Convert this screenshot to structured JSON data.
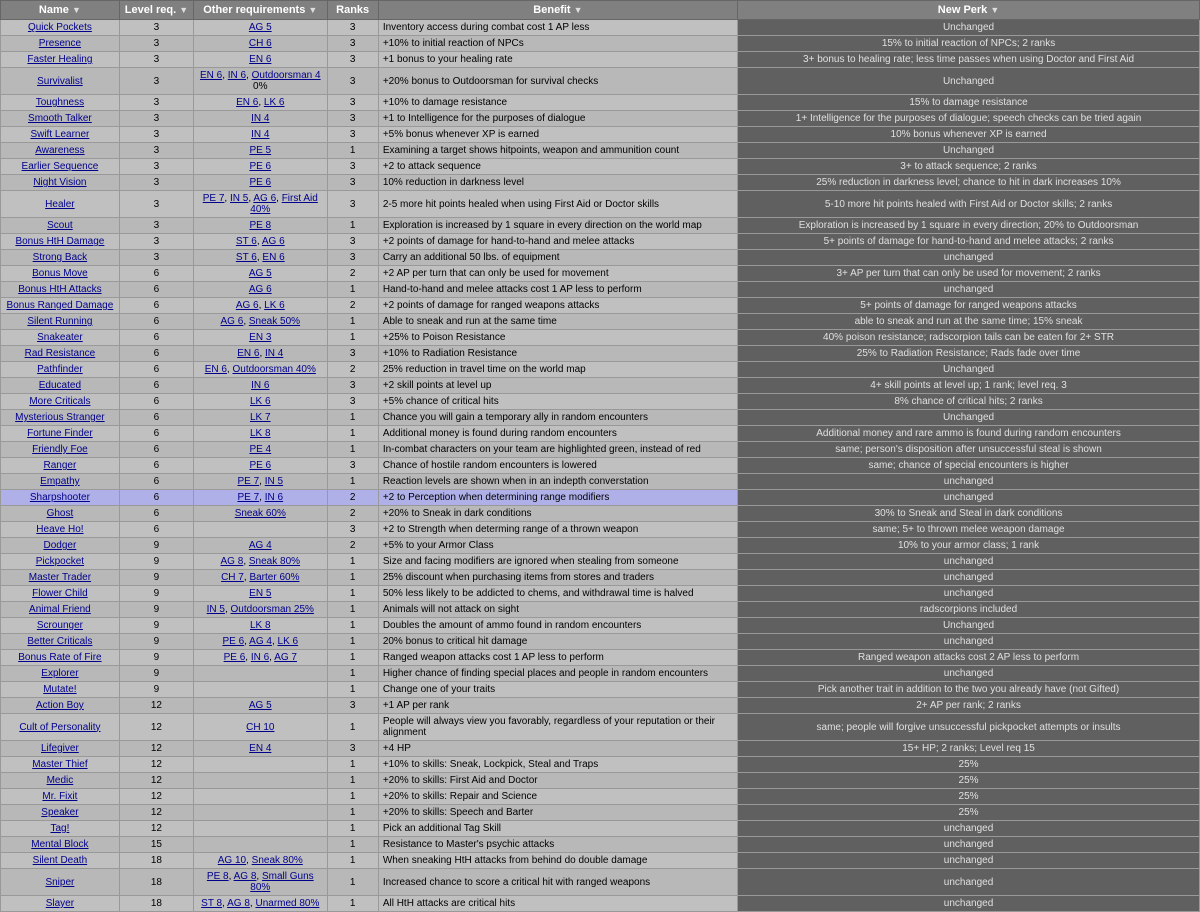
{
  "table": {
    "headers": [
      "Name",
      "Level req.",
      "Other requirements",
      "Ranks",
      "Benefit",
      "New Perk"
    ],
    "rows": [
      {
        "name": "Quick Pockets",
        "level": "3",
        "other": "AG 5",
        "ranks": "3",
        "benefit": "Inventory access during combat cost 1 AP less",
        "newperk": "Unchanged"
      },
      {
        "name": "Presence",
        "level": "3",
        "other": "CH 6",
        "ranks": "3",
        "benefit": "+10% to initial reaction of NPCs",
        "newperk": "15% to initial reaction of NPCs; 2 ranks"
      },
      {
        "name": "Faster Healing",
        "level": "3",
        "other": "EN 6",
        "ranks": "3",
        "benefit": "+1 bonus to your healing rate",
        "newperk": "3+ bonus to healing rate; less time passes when using Doctor and First Aid"
      },
      {
        "name": "Survivalist",
        "level": "3",
        "other": "EN 6, IN 6, Outdoorsman 4 0%",
        "ranks": "3",
        "benefit": "+20% bonus to Outdoorsman for survival checks",
        "newperk": "Unchanged"
      },
      {
        "name": "Toughness",
        "level": "3",
        "other": "EN 6, LK 6",
        "ranks": "3",
        "benefit": "+10% to damage resistance",
        "newperk": "15% to damage resistance"
      },
      {
        "name": "Smooth Talker",
        "level": "3",
        "other": "IN 4",
        "ranks": "3",
        "benefit": "+1 to Intelligence for the purposes of dialogue",
        "newperk": "1+ Intelligence for the purposes of dialogue; speech checks can be tried again"
      },
      {
        "name": "Swift Learner",
        "level": "3",
        "other": "IN 4",
        "ranks": "3",
        "benefit": "+5% bonus whenever XP is earned",
        "newperk": "10% bonus whenever XP is earned"
      },
      {
        "name": "Awareness",
        "level": "3",
        "other": "PE 5",
        "ranks": "1",
        "benefit": "Examining a target shows hitpoints, weapon and ammunition count",
        "newperk": "Unchanged"
      },
      {
        "name": "Earlier Sequence",
        "level": "3",
        "other": "PE 6",
        "ranks": "3",
        "benefit": "+2 to attack sequence",
        "newperk": "3+ to attack sequence; 2 ranks"
      },
      {
        "name": "Night Vision",
        "level": "3",
        "other": "PE 6",
        "ranks": "3",
        "benefit": "10% reduction in darkness level",
        "newperk": "25% reduction in darkness level; chance to hit in dark increases 10%"
      },
      {
        "name": "Healer",
        "level": "3",
        "other": "PE 7, IN 5, AG 6, First Aid 40%",
        "ranks": "3",
        "benefit": "2-5 more hit points healed when using First Aid or Doctor skills",
        "newperk": "5-10 more hit points healed with First Aid or Doctor skills; 2 ranks"
      },
      {
        "name": "Scout",
        "level": "3",
        "other": "PE 8",
        "ranks": "1",
        "benefit": "Exploration is increased by 1 square in every direction on the world map",
        "newperk": "Exploration is increased by 1 square in every direction; 20% to Outdoorsman"
      },
      {
        "name": "Bonus HtH Damage",
        "level": "3",
        "other": "ST 6, AG 6",
        "ranks": "3",
        "benefit": "+2 points of damage for hand-to-hand and melee attacks",
        "newperk": "5+ points of damage for hand-to-hand and melee attacks; 2 ranks"
      },
      {
        "name": "Strong Back",
        "level": "3",
        "other": "ST 6, EN 6",
        "ranks": "3",
        "benefit": "Carry an additional 50 lbs. of equipment",
        "newperk": "unchanged"
      },
      {
        "name": "Bonus Move",
        "level": "6",
        "other": "AG 5",
        "ranks": "2",
        "benefit": "+2 AP per turn that can only be used for movement",
        "newperk": "3+ AP per turn that can only be used for movement; 2 ranks"
      },
      {
        "name": "Bonus HtH Attacks",
        "level": "6",
        "other": "AG 6",
        "ranks": "1",
        "benefit": "Hand-to-hand and melee attacks cost 1 AP less to perform",
        "newperk": "unchanged"
      },
      {
        "name": "Bonus Ranged Damage",
        "level": "6",
        "other": "AG 6, LK 6",
        "ranks": "2",
        "benefit": "+2 points of damage for ranged weapons attacks",
        "newperk": "5+ points of damage for ranged weapons attacks"
      },
      {
        "name": "Silent Running",
        "level": "6",
        "other": "AG 6, Sneak 50%",
        "ranks": "1",
        "benefit": "Able to sneak and run at the same time",
        "newperk": "able to sneak and run at the same time; 15% sneak"
      },
      {
        "name": "Snakeater",
        "level": "6",
        "other": "EN 3",
        "ranks": "1",
        "benefit": "+25% to Poison Resistance",
        "newperk": "40% poison resistance; radscorpion tails can be eaten for 2+ STR"
      },
      {
        "name": "Rad Resistance",
        "level": "6",
        "other": "EN 6, IN 4",
        "ranks": "3",
        "benefit": "+10% to Radiation Resistance",
        "newperk": "25% to Radiation Resistance; Rads fade over time"
      },
      {
        "name": "Pathfinder",
        "level": "6",
        "other": "EN 6, Outdoorsman 40%",
        "ranks": "2",
        "benefit": "25% reduction in travel time on the world map",
        "newperk": "Unchanged"
      },
      {
        "name": "Educated",
        "level": "6",
        "other": "IN 6",
        "ranks": "3",
        "benefit": "+2 skill points at level up",
        "newperk": "4+ skill points at level up; 1 rank; level req. 3"
      },
      {
        "name": "More Criticals",
        "level": "6",
        "other": "LK 6",
        "ranks": "3",
        "benefit": "+5% chance of critical hits",
        "newperk": "8% chance of critical hits; 2 ranks"
      },
      {
        "name": "Mysterious Stranger",
        "level": "6",
        "other": "LK 7",
        "ranks": "1",
        "benefit": "Chance you will gain a temporary ally in random encounters",
        "newperk": "Unchanged"
      },
      {
        "name": "Fortune Finder",
        "level": "6",
        "other": "LK 8",
        "ranks": "1",
        "benefit": "Additional money is found during random encounters",
        "newperk": "Additional money and rare ammo is found during random encounters"
      },
      {
        "name": "Friendly Foe",
        "level": "6",
        "other": "PE 4",
        "ranks": "1",
        "benefit": "In-combat characters on your team are highlighted green, instead of red",
        "newperk": "same; person's disposition after unsuccessful steal is shown"
      },
      {
        "name": "Ranger",
        "level": "6",
        "other": "PE 6",
        "ranks": "3",
        "benefit": "Chance of hostile random encounters is lowered",
        "newperk": "same; chance of special encounters is higher"
      },
      {
        "name": "Empathy",
        "level": "6",
        "other": "PE 7, IN 5",
        "ranks": "1",
        "benefit": "Reaction levels are shown when in an indepth converstation",
        "newperk": "unchanged"
      },
      {
        "name": "Sharpshooter",
        "level": "6",
        "other": "PE 7, IN 6",
        "ranks": "2",
        "benefit": "+2 to Perception when determining range modifiers",
        "newperk": "unchanged",
        "highlighted": true
      },
      {
        "name": "Ghost",
        "level": "6",
        "other": "Sneak 60%",
        "ranks": "2",
        "benefit": "+20% to Sneak in dark conditions",
        "newperk": "30% to Sneak and Steal in dark conditions"
      },
      {
        "name": "Heave Ho!",
        "level": "6",
        "other": "",
        "ranks": "3",
        "benefit": "+2 to Strength when determing range of a thrown weapon",
        "newperk": "same; 5+ to thrown melee weapon damage"
      },
      {
        "name": "Dodger",
        "level": "9",
        "other": "AG 4",
        "ranks": "2",
        "benefit": "+5% to your Armor Class",
        "newperk": "10% to your armor class; 1 rank"
      },
      {
        "name": "Pickpocket",
        "level": "9",
        "other": "AG 8, Sneak 80%",
        "ranks": "1",
        "benefit": "Size and facing modifiers are ignored when stealing from someone",
        "newperk": "unchanged"
      },
      {
        "name": "Master Trader",
        "level": "9",
        "other": "CH 7, Barter 60%",
        "ranks": "1",
        "benefit": "25% discount when purchasing items from stores and traders",
        "newperk": "unchanged"
      },
      {
        "name": "Flower Child",
        "level": "9",
        "other": "EN 5",
        "ranks": "1",
        "benefit": "50% less likely to be addicted to chems, and withdrawal time is halved",
        "newperk": "unchanged"
      },
      {
        "name": "Animal Friend",
        "level": "9",
        "other": "IN 5, Outdoorsman 25%",
        "ranks": "1",
        "benefit": "Animals will not attack on sight",
        "newperk": "radscorpions included"
      },
      {
        "name": "Scrounger",
        "level": "9",
        "other": "LK 8",
        "ranks": "1",
        "benefit": "Doubles the amount of ammo found in random encounters",
        "newperk": "Unchanged"
      },
      {
        "name": "Better Criticals",
        "level": "9",
        "other": "PE 6, AG 4, LK 6",
        "ranks": "1",
        "benefit": "20% bonus to critical hit damage",
        "newperk": "unchanged"
      },
      {
        "name": "Bonus Rate of Fire",
        "level": "9",
        "other": "PE 6, IN 6, AG 7",
        "ranks": "1",
        "benefit": "Ranged weapon attacks cost 1 AP less to perform",
        "newperk": "Ranged weapon attacks cost 2 AP less to perform"
      },
      {
        "name": "Explorer",
        "level": "9",
        "other": "",
        "ranks": "1",
        "benefit": "Higher chance of finding special places and people in random encounters",
        "newperk": "unchanged"
      },
      {
        "name": "Mutate!",
        "level": "9",
        "other": "",
        "ranks": "1",
        "benefit": "Change one of your traits",
        "newperk": "Pick another trait in addition to the two you already have (not Gifted)"
      },
      {
        "name": "Action Boy",
        "level": "12",
        "other": "AG 5",
        "ranks": "3",
        "benefit": "+1 AP per rank",
        "newperk": "2+ AP per rank; 2 ranks"
      },
      {
        "name": "Cult of Personality",
        "level": "12",
        "other": "CH 10",
        "ranks": "1",
        "benefit": "People will always view you favorably, regardless of your reputation or their alignment",
        "newperk": "same; people will forgive unsuccessful pickpocket attempts or insults"
      },
      {
        "name": "Lifegiver",
        "level": "12",
        "other": "EN 4",
        "ranks": "3",
        "benefit": "+4 HP",
        "newperk": "15+ HP; 2 ranks; Level req 15"
      },
      {
        "name": "Master Thief",
        "level": "12",
        "other": "",
        "ranks": "1",
        "benefit": "+10% to skills: Sneak, Lockpick, Steal and Traps",
        "newperk": "25%"
      },
      {
        "name": "Medic",
        "level": "12",
        "other": "",
        "ranks": "1",
        "benefit": "+20% to skills: First Aid and Doctor",
        "newperk": "25%"
      },
      {
        "name": "Mr. Fixit",
        "level": "12",
        "other": "",
        "ranks": "1",
        "benefit": "+20% to skills: Repair and Science",
        "newperk": "25%"
      },
      {
        "name": "Speaker",
        "level": "12",
        "other": "",
        "ranks": "1",
        "benefit": "+20% to skills: Speech and Barter",
        "newperk": "25%"
      },
      {
        "name": "Tag!",
        "level": "12",
        "other": "",
        "ranks": "1",
        "benefit": "Pick an additional Tag Skill",
        "newperk": "unchanged"
      },
      {
        "name": "Mental Block",
        "level": "15",
        "other": "",
        "ranks": "1",
        "benefit": "Resistance to Master's psychic attacks",
        "newperk": "unchanged"
      },
      {
        "name": "Silent Death",
        "level": "18",
        "other": "AG 10, Sneak 80%",
        "ranks": "1",
        "benefit": "When sneaking HtH attacks from behind do double damage",
        "newperk": "unchanged"
      },
      {
        "name": "Sniper",
        "level": "18",
        "other": "PE 8, AG 8, Small Guns 80%",
        "ranks": "1",
        "benefit": "Increased chance to score a critical hit with ranged weapons",
        "newperk": "unchanged"
      },
      {
        "name": "Slayer",
        "level": "18",
        "other": "ST 8, AG 8, Unarmed 80%",
        "ranks": "1",
        "benefit": "All HtH attacks are critical hits",
        "newperk": "unchanged"
      }
    ]
  }
}
